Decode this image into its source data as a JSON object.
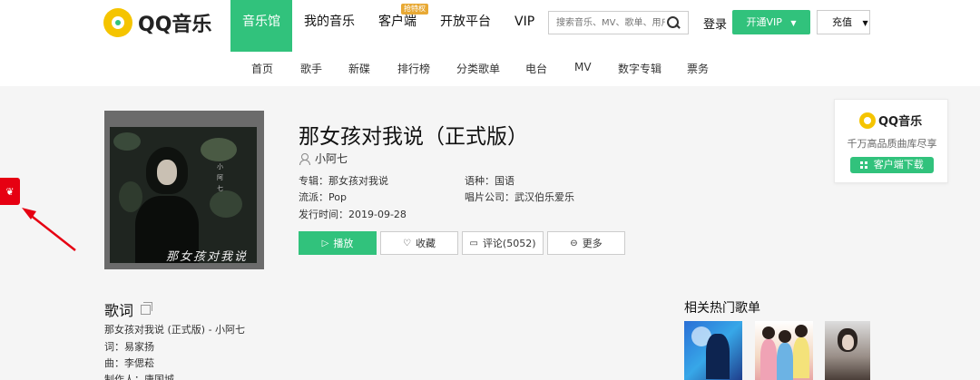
{
  "header": {
    "logo_text": "QQ音乐",
    "nav": [
      {
        "label": "音乐馆",
        "active": true
      },
      {
        "label": "我的音乐"
      },
      {
        "label": "客户端",
        "badge": "抢特权"
      },
      {
        "label": "开放平台"
      },
      {
        "label": "VIP"
      }
    ],
    "search_placeholder": "搜索音乐、MV、歌单、用户",
    "login": "登录",
    "vip_button": "开通VIP",
    "recharge_button": "充值"
  },
  "subnav": [
    "首页",
    "歌手",
    "新碟",
    "排行榜",
    "分类歌单",
    "电台",
    "MV",
    "数字专辑",
    "票务"
  ],
  "song": {
    "title": "那女孩对我说（正式版）",
    "singer": "小阿七",
    "album": "专辑：那女孩对我说",
    "language": "语种：国语",
    "genre": "流派：Pop",
    "label": "唱片公司：武汉伯乐爱乐",
    "release": "发行时间：2019-09-28",
    "cover_side_text": "小阿七",
    "cover_sign_text": "那女孩对我说"
  },
  "actions": {
    "play": "播放",
    "favorite": "收藏",
    "comments": "评论(5052)",
    "more": "更多"
  },
  "promo": {
    "name": "QQ音乐",
    "slogan": "千万高品质曲库尽享",
    "download": "客户端下载"
  },
  "lyrics": {
    "title": "歌词",
    "lines": [
      "那女孩对我说 (正式版) - 小阿七",
      "词：易家扬",
      "曲：李偲菘",
      "制作人：唐国城"
    ]
  },
  "related": {
    "title": "相关热门歌单"
  },
  "colors": {
    "brand_green": "#31c27c",
    "logo_yellow": "#f5c400",
    "side_tab_red": "#e60012"
  }
}
